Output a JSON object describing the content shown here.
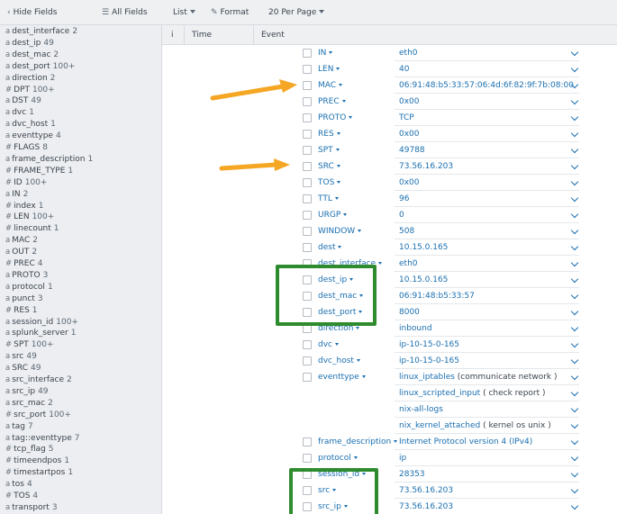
{
  "toolbar": {
    "hide_fields": "Hide Fields",
    "all_fields": "All Fields",
    "list": "List",
    "format": "Format",
    "per_page": "20 Per Page"
  },
  "header": {
    "info": "i",
    "time": "Time",
    "event": "Event"
  },
  "sidebar": {
    "fields": [
      {
        "type": "a",
        "name": "dest_interface",
        "count": "2"
      },
      {
        "type": "a",
        "name": "dest_ip",
        "count": "49"
      },
      {
        "type": "a",
        "name": "dest_mac",
        "count": "2"
      },
      {
        "type": "a",
        "name": "dest_port",
        "count": "100+"
      },
      {
        "type": "a",
        "name": "direction",
        "count": "2"
      },
      {
        "type": "#",
        "name": "DPT",
        "count": "100+"
      },
      {
        "type": "a",
        "name": "DST",
        "count": "49"
      },
      {
        "type": "a",
        "name": "dvc",
        "count": "1"
      },
      {
        "type": "a",
        "name": "dvc_host",
        "count": "1"
      },
      {
        "type": "a",
        "name": "eventtype",
        "count": "4"
      },
      {
        "type": "#",
        "name": "FLAGS",
        "count": "8"
      },
      {
        "type": "a",
        "name": "frame_description",
        "count": "1"
      },
      {
        "type": "#",
        "name": "FRAME_TYPE",
        "count": "1"
      },
      {
        "type": "#",
        "name": "ID",
        "count": "100+"
      },
      {
        "type": "a",
        "name": "IN",
        "count": "2"
      },
      {
        "type": "#",
        "name": "index",
        "count": "1"
      },
      {
        "type": "#",
        "name": "LEN",
        "count": "100+"
      },
      {
        "type": "#",
        "name": "linecount",
        "count": "1"
      },
      {
        "type": "a",
        "name": "MAC",
        "count": "2"
      },
      {
        "type": "a",
        "name": "OUT",
        "count": "2"
      },
      {
        "type": "#",
        "name": "PREC",
        "count": "4"
      },
      {
        "type": "a",
        "name": "PROTO",
        "count": "3"
      },
      {
        "type": "a",
        "name": "protocol",
        "count": "1"
      },
      {
        "type": "a",
        "name": "punct",
        "count": "3"
      },
      {
        "type": "#",
        "name": "RES",
        "count": "1"
      },
      {
        "type": "a",
        "name": "session_id",
        "count": "100+"
      },
      {
        "type": "a",
        "name": "splunk_server",
        "count": "1"
      },
      {
        "type": "#",
        "name": "SPT",
        "count": "100+"
      },
      {
        "type": "a",
        "name": "src",
        "count": "49"
      },
      {
        "type": "a",
        "name": "SRC",
        "count": "49"
      },
      {
        "type": "a",
        "name": "src_interface",
        "count": "2"
      },
      {
        "type": "a",
        "name": "src_ip",
        "count": "49"
      },
      {
        "type": "a",
        "name": "src_mac",
        "count": "2"
      },
      {
        "type": "#",
        "name": "src_port",
        "count": "100+"
      },
      {
        "type": "a",
        "name": "tag",
        "count": "7"
      },
      {
        "type": "a",
        "name": "tag::eventtype",
        "count": "7"
      },
      {
        "type": "#",
        "name": "tcp_flag",
        "count": "5"
      },
      {
        "type": "#",
        "name": "timeendpos",
        "count": "1"
      },
      {
        "type": "#",
        "name": "timestartpos",
        "count": "1"
      },
      {
        "type": "a",
        "name": "tos",
        "count": "4"
      },
      {
        "type": "#",
        "name": "TOS",
        "count": "4"
      },
      {
        "type": "a",
        "name": "transport",
        "count": "3"
      }
    ]
  },
  "event_fields": [
    {
      "key": "IN",
      "value": "eth0"
    },
    {
      "key": "LEN",
      "value": "40"
    },
    {
      "key": "MAC",
      "value": "06:91:48:b5:33:57:06:4d:6f:82:9f:7b:08:00"
    },
    {
      "key": "PREC",
      "value": "0x00"
    },
    {
      "key": "PROTO",
      "value": "TCP"
    },
    {
      "key": "RES",
      "value": "0x00"
    },
    {
      "key": "SPT",
      "value": "49788"
    },
    {
      "key": "SRC",
      "value": "73.56.16.203"
    },
    {
      "key": "TOS",
      "value": "0x00"
    },
    {
      "key": "TTL",
      "value": "96"
    },
    {
      "key": "URGP",
      "value": "0"
    },
    {
      "key": "WINDOW",
      "value": "508"
    },
    {
      "key": "dest",
      "value": "10.15.0.165"
    },
    {
      "key": "dest_interface",
      "value": "eth0"
    },
    {
      "key": "dest_ip",
      "value": "10.15.0.165"
    },
    {
      "key": "dest_mac",
      "value": "06:91:48:b5:33:57"
    },
    {
      "key": "dest_port",
      "value": "8000"
    },
    {
      "key": "direction",
      "value": "inbound"
    },
    {
      "key": "dvc",
      "value": "ip-10-15-0-165"
    },
    {
      "key": "dvc_host",
      "value": "ip-10-15-0-165"
    },
    {
      "key": "eventtype",
      "value": "linux_iptables",
      "extra": " (communicate network )"
    },
    {
      "key": "",
      "value": "linux_scripted_input",
      "extra": " ( check report )"
    },
    {
      "key": "",
      "value": "nix-all-logs",
      "extra": ""
    },
    {
      "key": "",
      "value": "nix_kernel_attached",
      "extra": " ( kernel os unix )"
    },
    {
      "key": "frame_description",
      "value": "Internet Protocol version 4 (IPv4)"
    },
    {
      "key": "protocol",
      "value": "ip"
    },
    {
      "key": "session_id",
      "value": "28353"
    },
    {
      "key": "src",
      "value": "73.56.16.203"
    },
    {
      "key": "src_ip",
      "value": "73.56.16.203"
    }
  ],
  "colors": {
    "annotation_box": "#2e8b2e",
    "annotation_arrow": "#f5a623",
    "link": "#1a6fb0"
  }
}
